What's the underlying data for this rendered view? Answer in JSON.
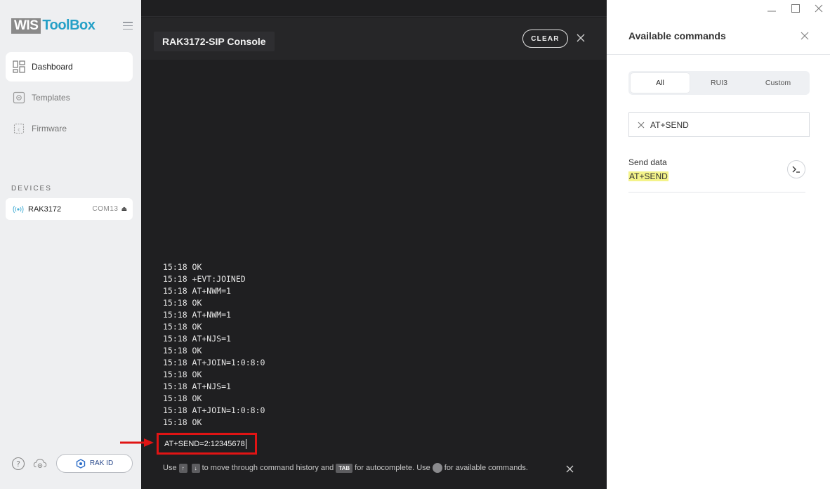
{
  "sidebar": {
    "logo_wis": "WIS",
    "logo_toolbox": "ToolBox",
    "nav": [
      {
        "label": "Dashboard",
        "icon": "dashboard-icon",
        "active": true
      },
      {
        "label": "Templates",
        "icon": "templates-icon",
        "active": false
      },
      {
        "label": "Firmware",
        "icon": "firmware-icon",
        "active": false
      }
    ],
    "devices_title": "DEVICES",
    "device": {
      "name": "RAK3172",
      "port": "COM13",
      "icon": "radio-signal-icon"
    },
    "rak_id_label": "RAK ID"
  },
  "console": {
    "title": "RAK3172-SIP Console",
    "clear_label": "CLEAR",
    "log": [
      "15:18 OK",
      "15:18 +EVT:JOINED",
      "15:18 AT+NWM=1",
      "15:18 OK",
      "15:18 AT+NWM=1",
      "15:18 OK",
      "15:18 AT+NJS=1",
      "15:18 OK",
      "15:18 AT+JOIN=1:0:8:0",
      "15:18 OK",
      "15:18 AT+NJS=1",
      "15:18 OK",
      "15:18 AT+JOIN=1:0:8:0",
      "15:18 OK"
    ],
    "input_value": "AT+SEND=2:12345678",
    "hint": {
      "use": "Use",
      "key_up": "↑",
      "key_down": "↓",
      "history": "to move through command history and",
      "key_tab": "TAB",
      "autocomplete": "for autocomplete. Use",
      "available": "for available commands."
    },
    "accent_color": "#e01414"
  },
  "panel": {
    "title": "Available commands",
    "tabs": [
      {
        "label": "All",
        "active": true
      },
      {
        "label": "RUI3",
        "active": false
      },
      {
        "label": "Custom",
        "active": false
      }
    ],
    "search_value": "AT+SEND",
    "result": {
      "name": "Send data",
      "command": "AT+SEND",
      "run_icon": "terminal-prompt-icon"
    },
    "highlight_color": "#f4f38a"
  }
}
